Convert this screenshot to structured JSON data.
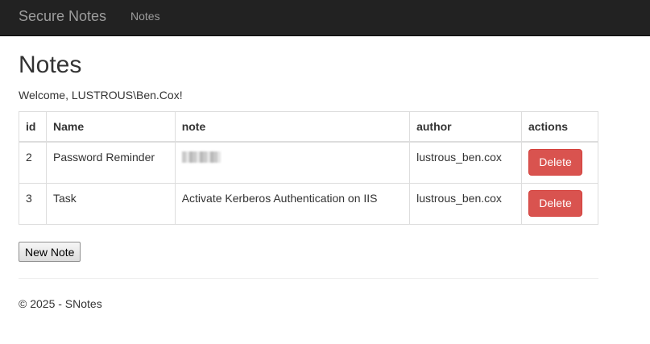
{
  "navbar": {
    "brand": "Secure Notes",
    "links": [
      "Notes"
    ]
  },
  "page": {
    "title": "Notes",
    "welcome": "Welcome, LUSTROUS\\Ben.Cox!"
  },
  "table": {
    "headers": [
      "id",
      "Name",
      "note",
      "author",
      "actions"
    ],
    "rows": [
      {
        "id": "2",
        "name": "Password Reminder",
        "note": "",
        "note_redacted": true,
        "author": "lustrous_ben.cox",
        "action": "Delete"
      },
      {
        "id": "3",
        "name": "Task",
        "note": "Activate Kerberos Authentication on IIS",
        "author": "lustrous_ben.cox",
        "action": "Delete"
      }
    ]
  },
  "buttons": {
    "new_note": "New Note"
  },
  "footer": {
    "text": "© 2025 - SNotes"
  },
  "colors": {
    "navbar_bg": "#222222",
    "nav_text": "#9d9d9d",
    "danger": "#d9534f"
  }
}
